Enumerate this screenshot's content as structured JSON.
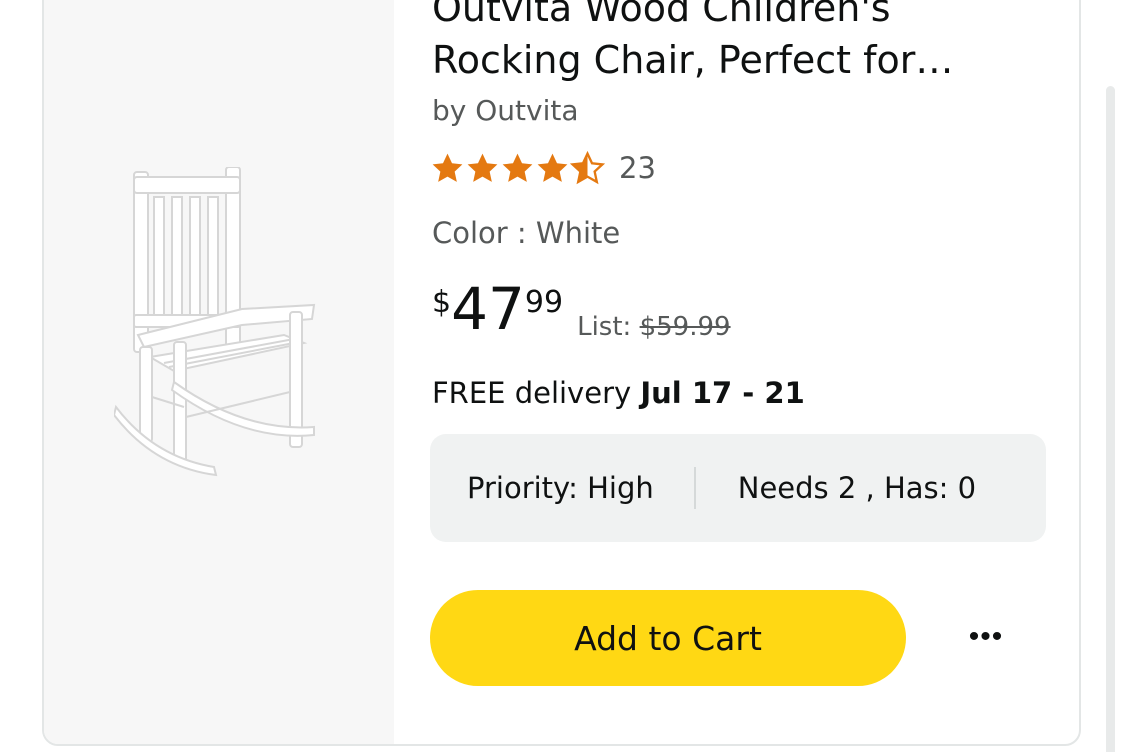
{
  "product": {
    "title_line1": "Outvita Wood Children's",
    "title_line2": "Rocking Chair, Perfect for…",
    "byline": "by Outvita",
    "rating": {
      "stars": 4.5,
      "count": "23"
    },
    "color": {
      "label": "Color : White"
    },
    "image_icon": "rocking-chair-image",
    "price": {
      "symbol": "$",
      "whole": "47",
      "fraction": "99",
      "list_label": "List:",
      "list_value": "$59.99"
    },
    "delivery": {
      "prefix": "FREE delivery",
      "dates": "Jul 17 - 21"
    },
    "priority": {
      "priority_text": "Priority: High",
      "needs_text": "Needs 2 , Has: 0"
    },
    "actions": {
      "add_to_cart_label": "Add to Cart",
      "more_label": "•••"
    }
  },
  "colors": {
    "star": "#e47911",
    "cart_button": "#ffd814",
    "priority_bg": "#f0f2f2",
    "image_bg": "#f7f7f7"
  }
}
